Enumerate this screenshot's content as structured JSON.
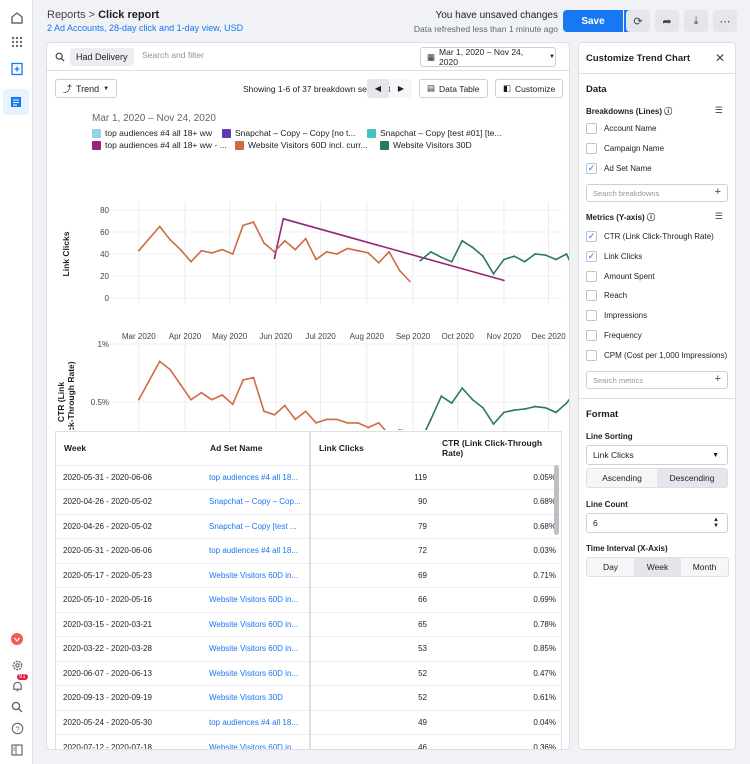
{
  "sidebar": {
    "icons": [
      "home-icon",
      "apps-grid-icon",
      "add-report-icon",
      "reports-icon"
    ],
    "bottom_icons": [
      "brand-icon",
      "settings-icon",
      "notifications-icon",
      "search-icon",
      "help-icon",
      "panel-toggle-icon"
    ],
    "notification_count": "91"
  },
  "header": {
    "breadcrumb_root": "Reports",
    "breadcrumb_sep": ">",
    "title": "Click report",
    "subtitle": "2 Ad Accounts, 28-day click and 1-day view, USD",
    "unsaved": "You have unsaved changes",
    "refreshed": "Data refreshed less than 1 minute ago",
    "save_label": "Save"
  },
  "filters": {
    "pill": "Had Delivery",
    "search_placeholder": "Search and filter",
    "date_range": "Mar 1, 2020 – Nov 24, 2020"
  },
  "controls": {
    "view": "Trend",
    "showing": "Showing 1-6 of 37 breakdown segments",
    "data_table": "Data Table",
    "customize": "Customize"
  },
  "chart_header": {
    "date_range": "Mar 1, 2020 – Nov 24, 2020"
  },
  "chart_data": [
    {
      "type": "line",
      "ylabel": "Link Clicks",
      "ylim": [
        0,
        80
      ],
      "yticks": [
        "80",
        "60",
        "40",
        "20",
        "0"
      ],
      "x_ticks": [
        "Mar 2020",
        "Apr 2020",
        "May 2020",
        "Jun 2020",
        "Jul 2020",
        "Aug 2020",
        "Sep 2020",
        "Oct 2020",
        "Nov 2020",
        "Dec 2020"
      ],
      "x_range": [
        "2020-02-10",
        "2020-12-10"
      ],
      "series": [
        {
          "name": "top audiences #4 all 18+ ww",
          "color": "#90d1ec",
          "points": []
        },
        {
          "name": "Snapchat – Copy – Copy [no t...",
          "color": "#6237b3",
          "points": []
        },
        {
          "name": "Snapchat – Copy [test #01] [te...",
          "color": "#40c3c1",
          "points": []
        },
        {
          "name": "top audiences #4 all 18+ ww - ...",
          "color": "#982578",
          "points": [
            [
              "2020-05-31",
              36
            ],
            [
              "2020-06-06",
              72
            ],
            [
              "2020-11-01",
              16
            ]
          ]
        },
        {
          "name": "Website Visitors 60D incl. curr...",
          "color": "#d06a45",
          "points": [
            [
              "2020-03-01",
              43
            ],
            [
              "2020-03-15",
              65
            ],
            [
              "2020-03-22",
              53
            ],
            [
              "2020-03-29",
              44
            ],
            [
              "2020-04-05",
              33
            ],
            [
              "2020-04-12",
              43
            ],
            [
              "2020-04-19",
              41
            ],
            [
              "2020-04-26",
              44
            ],
            [
              "2020-05-03",
              40
            ],
            [
              "2020-05-10",
              66
            ],
            [
              "2020-05-17",
              69
            ],
            [
              "2020-05-24",
              50
            ],
            [
              "2020-05-31",
              42
            ],
            [
              "2020-06-07",
              52
            ],
            [
              "2020-06-14",
              44
            ],
            [
              "2020-06-21",
              54
            ],
            [
              "2020-06-28",
              35
            ],
            [
              "2020-07-05",
              42
            ],
            [
              "2020-07-12",
              40
            ],
            [
              "2020-07-19",
              45
            ],
            [
              "2020-07-26",
              43
            ],
            [
              "2020-08-02",
              41
            ],
            [
              "2020-08-09",
              32
            ],
            [
              "2020-08-16",
              42
            ],
            [
              "2020-08-23",
              25
            ],
            [
              "2020-08-30",
              15
            ]
          ]
        },
        {
          "name": "Website Visitors 30D",
          "color": "#2a7a55",
          "points": [
            [
              "2020-09-06",
              34
            ],
            [
              "2020-09-13",
              42
            ],
            [
              "2020-09-20",
              37
            ],
            [
              "2020-09-27",
              33
            ],
            [
              "2020-10-04",
              52
            ],
            [
              "2020-10-11",
              46
            ],
            [
              "2020-10-18",
              38
            ],
            [
              "2020-10-25",
              22
            ],
            [
              "2020-11-01",
              35
            ],
            [
              "2020-11-08",
              38
            ],
            [
              "2020-11-15",
              33
            ],
            [
              "2020-11-22",
              40
            ],
            [
              "2020-11-29",
              39
            ],
            [
              "2020-12-06",
              35
            ],
            [
              "2020-12-13",
              40
            ],
            [
              "2020-12-20",
              20
            ]
          ]
        }
      ]
    },
    {
      "type": "line",
      "ylabel": "CTR (Link Click-Through Rate)",
      "ylim": [
        0,
        1
      ],
      "yticks": [
        "1%",
        "0.5%",
        "0%"
      ],
      "series": [
        {
          "name": "top audiences #4 all 18+ ww - ...",
          "color": "#982578",
          "points": [
            [
              "2020-05-31",
              0.04
            ],
            [
              "2020-11-01",
              0.09
            ]
          ]
        },
        {
          "name": "Website Visitors 60D incl. curr...",
          "color": "#d06a45",
          "points": [
            [
              "2020-03-01",
              0.52
            ],
            [
              "2020-03-15",
              0.85
            ],
            [
              "2020-03-22",
              0.78
            ],
            [
              "2020-03-29",
              0.65
            ],
            [
              "2020-04-05",
              0.52
            ],
            [
              "2020-04-12",
              0.58
            ],
            [
              "2020-04-19",
              0.52
            ],
            [
              "2020-04-26",
              0.56
            ],
            [
              "2020-05-03",
              0.48
            ],
            [
              "2020-05-10",
              0.69
            ],
            [
              "2020-05-17",
              0.71
            ],
            [
              "2020-05-24",
              0.42
            ],
            [
              "2020-05-31",
              0.39
            ],
            [
              "2020-06-07",
              0.47
            ],
            [
              "2020-06-14",
              0.35
            ],
            [
              "2020-06-21",
              0.42
            ],
            [
              "2020-06-28",
              0.32
            ],
            [
              "2020-07-05",
              0.35
            ],
            [
              "2020-07-12",
              0.35
            ],
            [
              "2020-07-19",
              0.32
            ],
            [
              "2020-07-26",
              0.32
            ],
            [
              "2020-08-02",
              0.28
            ],
            [
              "2020-08-09",
              0.32
            ],
            [
              "2020-08-16",
              0.22
            ],
            [
              "2020-08-23",
              0.26
            ],
            [
              "2020-08-30",
              0.24
            ]
          ]
        },
        {
          "name": "Website Visitors 30D",
          "color": "#2a7a55",
          "points": [
            [
              "2020-09-06",
              0.16
            ],
            [
              "2020-09-13",
              0.35
            ],
            [
              "2020-09-20",
              0.55
            ],
            [
              "2020-09-27",
              0.49
            ],
            [
              "2020-10-04",
              0.62
            ],
            [
              "2020-10-11",
              0.52
            ],
            [
              "2020-10-18",
              0.45
            ],
            [
              "2020-10-25",
              0.31
            ],
            [
              "2020-11-01",
              0.41
            ],
            [
              "2020-11-08",
              0.43
            ],
            [
              "2020-11-15",
              0.44
            ],
            [
              "2020-11-22",
              0.46
            ],
            [
              "2020-11-29",
              0.45
            ],
            [
              "2020-12-06",
              0.41
            ],
            [
              "2020-12-13",
              0.49
            ],
            [
              "2020-12-20",
              0.61
            ]
          ]
        }
      ]
    }
  ],
  "table": {
    "headers": [
      "Week",
      "Ad Set Name",
      "Link Clicks",
      "CTR (Link Click-Through Rate)"
    ],
    "rows": [
      [
        "2020-05-31 - 2020-06-06",
        "top audiences #4 all 18...",
        "119",
        "0.05%"
      ],
      [
        "2020-04-26 - 2020-05-02",
        "Snapchat – Copy – Cop...",
        "90",
        "0.68%"
      ],
      [
        "2020-04-26 - 2020-05-02",
        "Snapchat – Copy [test ...",
        "79",
        "0.68%"
      ],
      [
        "2020-05-31 - 2020-06-06",
        "top audiences #4 all 18...",
        "72",
        "0.03%"
      ],
      [
        "2020-05-17 - 2020-05-23",
        "Website Visitors 60D in...",
        "69",
        "0.71%"
      ],
      [
        "2020-05-10 - 2020-05-16",
        "Website Visitors 60D in...",
        "66",
        "0.69%"
      ],
      [
        "2020-03-15 - 2020-03-21",
        "Website Visitors 60D in...",
        "65",
        "0.78%"
      ],
      [
        "2020-03-22 - 2020-03-28",
        "Website Visitors 60D in...",
        "53",
        "0.85%"
      ],
      [
        "2020-06-07 - 2020-06-13",
        "Website Visitors 60D in...",
        "52",
        "0.47%"
      ],
      [
        "2020-09-13 - 2020-09-19",
        "Website Visitors 30D",
        "52",
        "0.61%"
      ],
      [
        "2020-05-24 - 2020-05-30",
        "top audiences #4 all 18...",
        "49",
        "0.04%"
      ],
      [
        "2020-07-12 - 2020-07-18",
        "Website Visitors 60D in...",
        "46",
        "0.36%"
      ]
    ]
  },
  "panel": {
    "title": "Customize Trend Chart",
    "data_heading": "Data",
    "breakdowns_label": "Breakdowns (Lines)",
    "breakdowns": [
      {
        "label": "Account Name",
        "checked": false
      },
      {
        "label": "Campaign Name",
        "checked": false
      },
      {
        "label": "Ad Set Name",
        "checked": true
      }
    ],
    "search_breakdowns": "Search breakdowns",
    "metrics_label": "Metrics (Y-axis)",
    "metrics": [
      {
        "label": "CTR (Link Click-Through Rate)",
        "checked": true
      },
      {
        "label": "Link Clicks",
        "checked": true
      },
      {
        "label": "Amount Spent",
        "checked": false
      },
      {
        "label": "Reach",
        "checked": false
      },
      {
        "label": "Impressions",
        "checked": false
      },
      {
        "label": "Frequency",
        "checked": false
      },
      {
        "label": "CPM (Cost per 1,000 Impressions)",
        "checked": false
      }
    ],
    "search_metrics": "Search metrics",
    "format_heading": "Format",
    "line_sorting_label": "Line Sorting",
    "line_sorting_value": "Link Clicks",
    "asc": "Ascending",
    "desc": "Descending",
    "line_count_label": "Line Count",
    "line_count_value": "6",
    "interval_label": "Time Interval (X-Axis)",
    "interval_options": [
      "Day",
      "Week",
      "Month"
    ],
    "interval_selected": "Week"
  }
}
